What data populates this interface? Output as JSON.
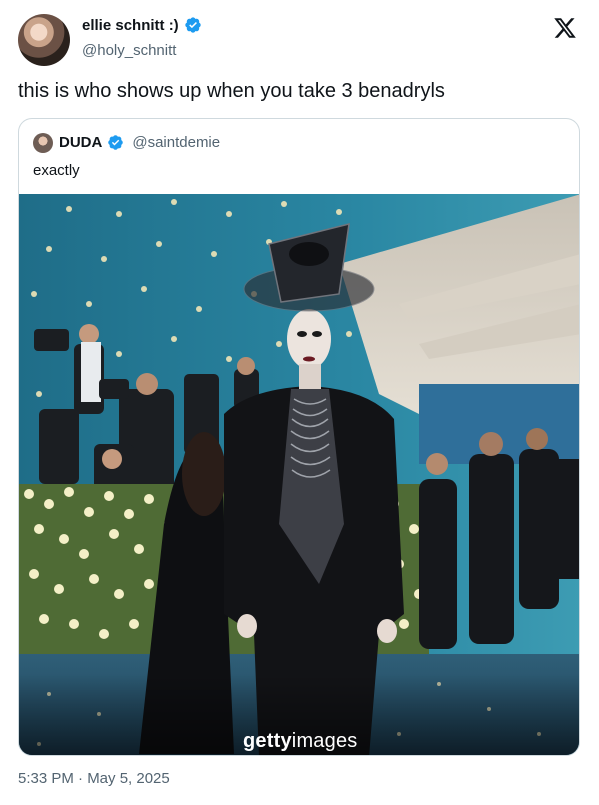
{
  "author": {
    "display_name": "ellie schnitt :)",
    "handle": "@holy_schnitt",
    "verified": true
  },
  "tweet": {
    "text": "this is who shows up when you take 3 benadryls",
    "timestamp": "5:33 PM · May 5, 2025"
  },
  "quoted_tweet": {
    "display_name": "DUDA",
    "handle": "@saintdemie",
    "verified": true,
    "text": "exactly",
    "media": {
      "watermark_bold": "getty",
      "watermark_light": "images"
    }
  },
  "icons": {
    "platform_logo": "x-logo-icon",
    "verified_badge": "verified-badge-icon"
  },
  "colors": {
    "verified_blue": "#1d9bf0",
    "secondary_text": "#536471",
    "border": "#cfd9de"
  }
}
